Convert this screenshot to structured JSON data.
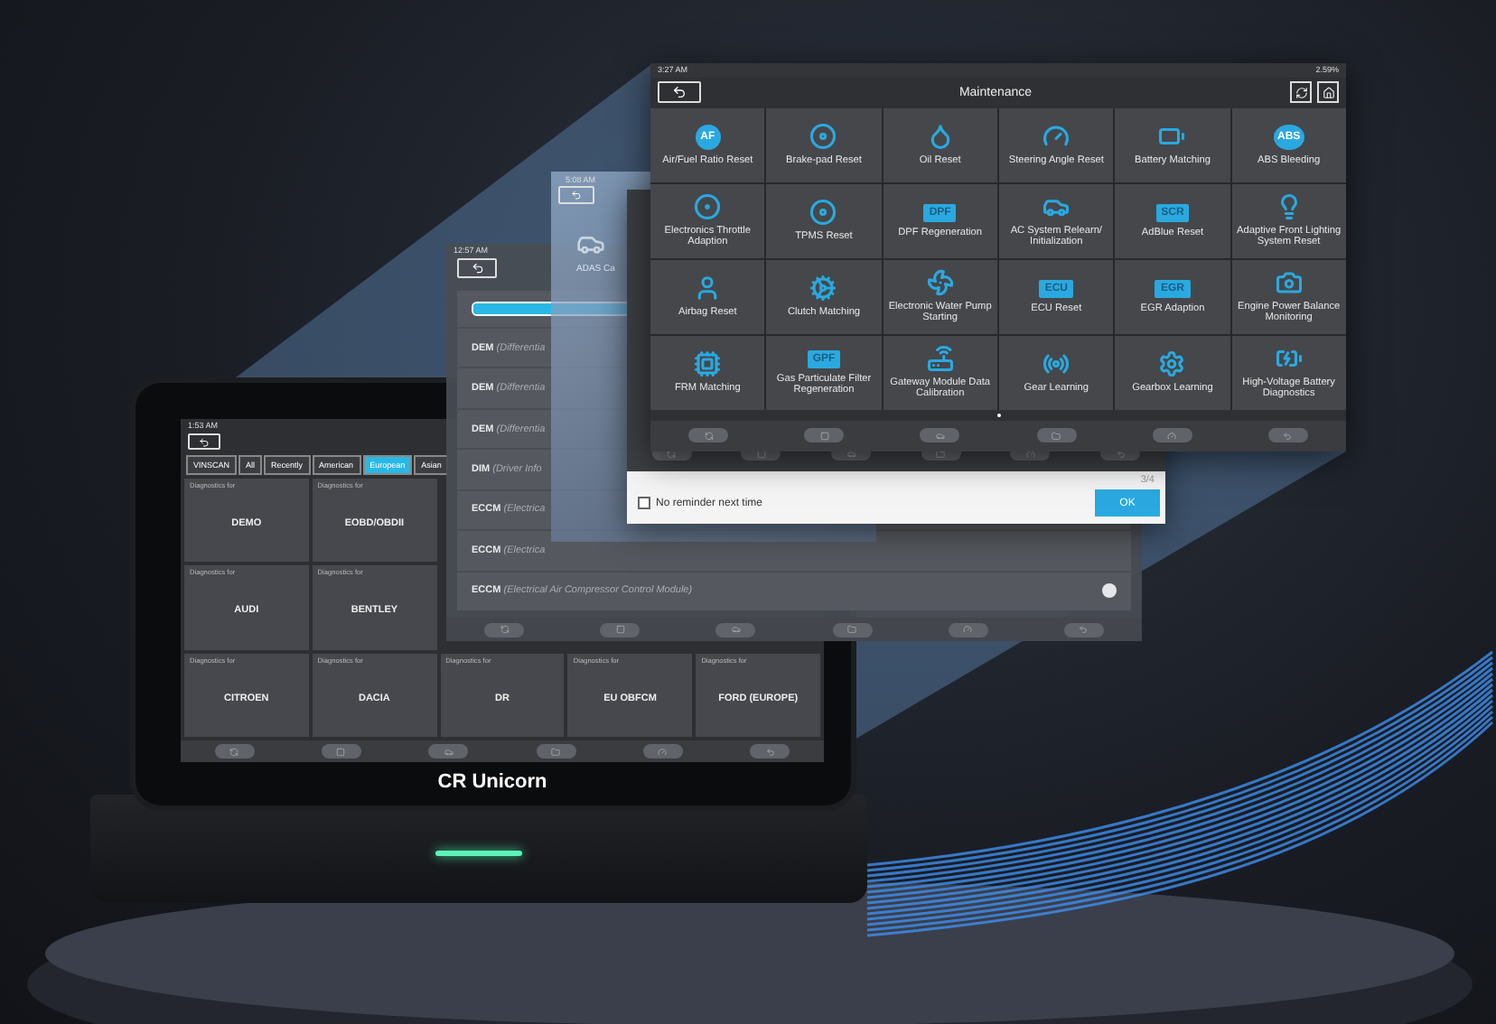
{
  "maintenance_panel": {
    "status_time": "3:27 AM",
    "battery": "2.59%",
    "title": "Maintenance",
    "items": [
      {
        "label": "Air/Fuel Ratio Reset",
        "kind": "badge",
        "badge": "AF"
      },
      {
        "label": "Brake-pad Reset",
        "kind": "glyph"
      },
      {
        "label": "Oil Reset",
        "kind": "glyph"
      },
      {
        "label": "Steering Angle Reset",
        "kind": "glyph"
      },
      {
        "label": "Battery Matching",
        "kind": "glyph"
      },
      {
        "label": "ABS Bleeding",
        "kind": "badge",
        "badge": "ABS"
      },
      {
        "label": "Electronics Throttle Adaption",
        "kind": "glyph"
      },
      {
        "label": "TPMS Reset",
        "kind": "glyph"
      },
      {
        "label": "DPF Regeneration",
        "kind": "badge",
        "badge": "DPF"
      },
      {
        "label": "AC System Relearn/ Initialization",
        "kind": "glyph"
      },
      {
        "label": "AdBlue Reset",
        "kind": "badge",
        "badge": "SCR"
      },
      {
        "label": "Adaptive Front Lighting System Reset",
        "kind": "glyph"
      },
      {
        "label": "Airbag Reset",
        "kind": "glyph"
      },
      {
        "label": "Clutch Matching",
        "kind": "glyph"
      },
      {
        "label": "Electronic Water Pump Starting",
        "kind": "glyph"
      },
      {
        "label": "ECU Reset",
        "kind": "badge",
        "badge": "ECU"
      },
      {
        "label": "EGR Adaption",
        "kind": "badge",
        "badge": "EGR"
      },
      {
        "label": "Engine Power Balance Monitoring",
        "kind": "glyph"
      },
      {
        "label": "FRM Matching",
        "kind": "glyph"
      },
      {
        "label": "Gas Particulate Filter Regeneration",
        "kind": "badge",
        "badge": "GPF"
      },
      {
        "label": "Gateway Module Data Calibration",
        "kind": "glyph"
      },
      {
        "label": "Gear Learning",
        "kind": "glyph"
      },
      {
        "label": "Gearbox Learning",
        "kind": "glyph"
      },
      {
        "label": "High-Voltage Battery Diagnostics",
        "kind": "glyph"
      }
    ]
  },
  "dialog": {
    "page": "3/4",
    "checkbox": {
      "label": "No reminder next time",
      "checked": false
    },
    "ok_button": "OK"
  },
  "adas_screen": {
    "status_time": "5:08 AM",
    "item_label": "ADAS Ca"
  },
  "module_list_screen": {
    "status_time": "12:57 AM",
    "progress": {
      "level": 1
    },
    "rows": [
      {
        "code": "DEM",
        "detail": "(Differentia"
      },
      {
        "code": "DEM",
        "detail": "(Differentia"
      },
      {
        "code": "DEM",
        "detail": "(Differentia"
      },
      {
        "code": "DIM",
        "detail": "(Driver Info"
      },
      {
        "code": "ECCM",
        "detail": "(Electrica"
      },
      {
        "code": "ECCM",
        "detail": "(Electrica"
      },
      {
        "code": "ECCM",
        "detail": "(Electrical Air Compressor Control Module)"
      }
    ]
  },
  "tablet": {
    "brand": "CR Unicorn",
    "status_time": "1:53 AM",
    "tabs": [
      {
        "label": "VINSCAN",
        "selected": false
      },
      {
        "label": "All",
        "selected": false
      },
      {
        "label": "Recently",
        "selected": false
      },
      {
        "label": "American",
        "selected": false
      },
      {
        "label": "European",
        "selected": true
      },
      {
        "label": "Asian",
        "selected": false
      }
    ],
    "card_rows": [
      [
        {
          "caption": "Diagnostics for",
          "name": "DEMO"
        },
        {
          "caption": "Diagnostics for",
          "name": "EOBD/OBDII"
        }
      ],
      [
        {
          "caption": "Diagnostics for",
          "name": "AUDI"
        },
        {
          "caption": "Diagnostics for",
          "name": "BENTLEY"
        }
      ],
      [
        {
          "caption": "Diagnostics for",
          "name": "CITROEN"
        },
        {
          "caption": "Diagnostics for",
          "name": "DACIA"
        },
        {
          "caption": "Diagnostics for",
          "name": "DR"
        },
        {
          "caption": "Diagnostics for",
          "name": "EU OBFCM"
        },
        {
          "caption": "Diagnostics for",
          "name": "FORD (EUROPE)"
        }
      ]
    ]
  }
}
